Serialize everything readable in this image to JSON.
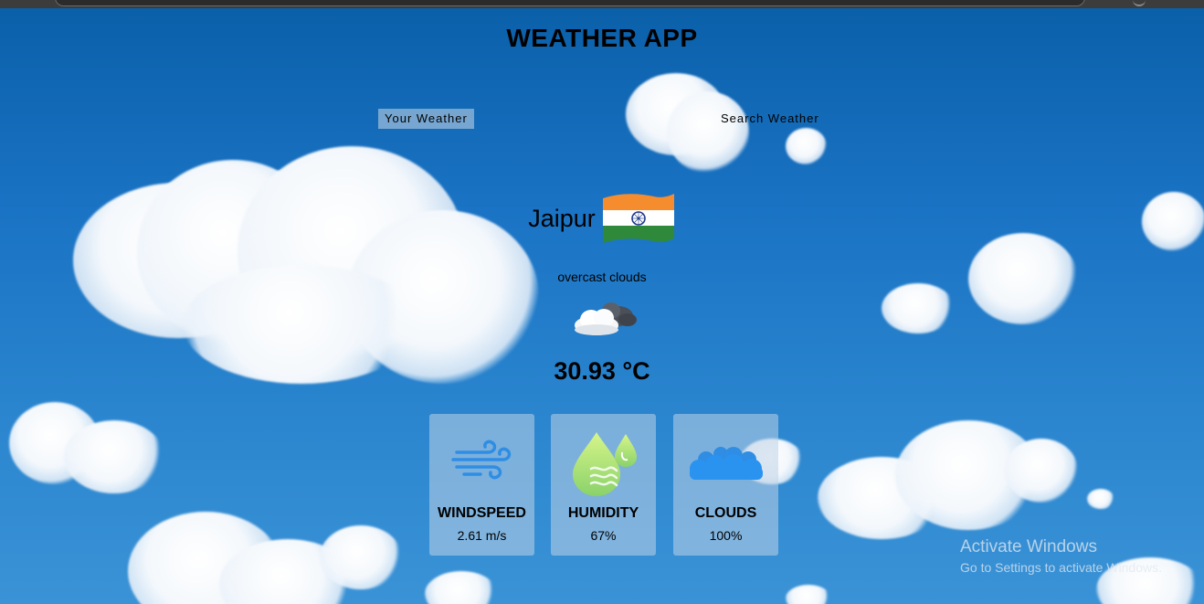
{
  "app": {
    "title": "WEATHER APP"
  },
  "tabs": [
    {
      "label": "Your Weather",
      "active": true
    },
    {
      "label": "Search Weather",
      "active": false
    }
  ],
  "weather": {
    "city": "Jaipur",
    "country_flag": "india-flag-icon",
    "description": "overcast clouds",
    "icon": "overcast-clouds-icon",
    "temperature": "30.93 °C"
  },
  "stats": [
    {
      "label": "WINDSPEED",
      "value": "2.61 m/s",
      "icon": "wind-icon"
    },
    {
      "label": "HUMIDITY",
      "value": "67%",
      "icon": "humidity-icon"
    },
    {
      "label": "CLOUDS",
      "value": "100%",
      "icon": "clouds-icon"
    }
  ],
  "os_watermark": {
    "line1": "Activate Windows",
    "line2": "Go to Settings to activate Windows."
  },
  "colors": {
    "sky": "#1a73c4",
    "card": "#bed2e6",
    "accent_blue": "#2f8de4",
    "humidity_green": "#a8e063"
  }
}
